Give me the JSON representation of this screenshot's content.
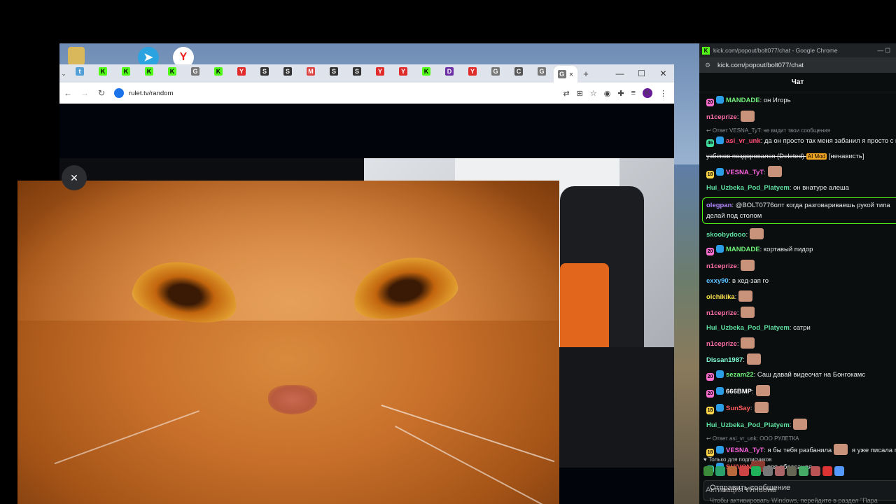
{
  "browser": {
    "url": "rulet.tv/random",
    "tab_icons": [
      "t",
      "K",
      "K",
      "K",
      "K",
      "G",
      "K",
      "Y",
      "S",
      "S",
      "M",
      "S",
      "S",
      "Y",
      "Y",
      "K",
      "D",
      "Y",
      "G",
      "C",
      "G",
      "G"
    ]
  },
  "chat_window": {
    "title": "kick.com/popout/bolt077/chat - Google Chrome",
    "url": "kick.com/popout/bolt077/chat",
    "header": "Чат"
  },
  "messages": [
    {
      "badge": "20",
      "user": "MANDADE",
      "color": "#6ff07a",
      "text": ": он Игорь"
    },
    {
      "user": "n1ceprize",
      "color": "#ff6fa8",
      "text": ":",
      "emote": true
    },
    {
      "reply": "↩ Ответ VESNA_TyT: не видит твои сообщения"
    },
    {
      "badge": "46",
      "user": "asi_vr_unk",
      "color": "#ff4f74",
      "text": ": да он просто так меня забанил я просто с м"
    },
    {
      "text2": "узбеков поздоровался (Deleted) ",
      "mod": "AI Mod",
      "tail": " [ненависть]"
    },
    {
      "badge": "18",
      "user": "VESNA_TyT",
      "color": "#ff63e0",
      "text": ":",
      "emote": true
    },
    {
      "user": "Hui_Uzbeka_Pod_Platyem",
      "color": "#5ee0a1",
      "text": ": он внатуре алеша"
    },
    {
      "highlight": true,
      "user": "olegpan",
      "color": "#b388ff",
      "text": ": @BOLT0776олт когда разговариваешь рукой типа делай под столом"
    },
    {
      "user": "skoobydooo",
      "color": "#5ee0a1",
      "text": ":",
      "emote": true
    },
    {
      "badge": "20",
      "user": "MANDADE",
      "color": "#6ff07a",
      "text": ": кортавый пидор"
    },
    {
      "user": "n1ceprize",
      "color": "#ff6fa8",
      "text": ":",
      "emote": true
    },
    {
      "user": "exxy90",
      "color": "#5bc0ff",
      "text": ": в хед-зап го"
    },
    {
      "user": "olchikika",
      "color": "#ffe14d",
      "text": ":",
      "emote": true
    },
    {
      "user": "n1ceprize",
      "color": "#ff6fa8",
      "text": ":",
      "emote": true
    },
    {
      "user": "Hui_Uzbeka_Pod_Platyem",
      "color": "#5ee0a1",
      "text": ": сатри"
    },
    {
      "user": "n1ceprize",
      "color": "#ff6fa8",
      "text": ":",
      "emote": true
    },
    {
      "user": "Dissan1987",
      "color": "#7fffd4",
      "text": ":",
      "emote": true
    },
    {
      "badge": "20",
      "user": "sezam22",
      "color": "#6ff07a",
      "text": ": Саш давай видеочат на Бонгокамс"
    },
    {
      "badge": "20",
      "user": "666BMP",
      "color": "#ffffff",
      "text": ":",
      "emote": true
    },
    {
      "badge": "18",
      "user": "SunSay",
      "color": "#ff5a5a",
      "text": ":",
      "emote": true
    },
    {
      "user": "Hui_Uzbeka_Pod_Platyem",
      "color": "#5ee0a1",
      "text": ":",
      "emote": true
    },
    {
      "reply": "↩ Ответ asi_vr_unk: ООО РУЛЕТКА"
    },
    {
      "badge": "18",
      "user": "VESNA_TyT",
      "color": "#ff63e0",
      "text": ": я бы тебя разбанила",
      "extra": " я уже писала под замес попал"
    },
    {
      "badge": "31",
      "user": "SHIVON",
      "color": "#ff4f4f",
      "text": " тля обоссаная",
      "emote_before": true
    }
  ],
  "subs_label": "Только для подписчиков",
  "input_placeholder": "Отправить сообщение",
  "watermark": {
    "line1": "Активация Windows",
    "line2": "Чтобы активировать Windows, перейдите в раздел \"Пара"
  },
  "colors": {
    "kick_green": "#53fc18"
  }
}
